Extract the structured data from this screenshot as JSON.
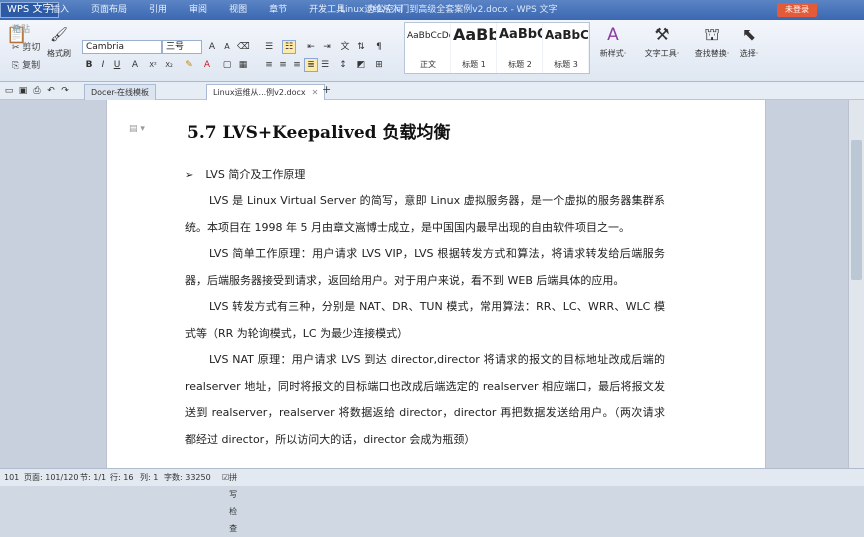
{
  "app": {
    "name": "WPS 文字",
    "doc_title": "Linux运维从入门到高级全套案例v2.docx - WPS 文字",
    "login_label": "未登录"
  },
  "menu": [
    "插入",
    "页面布局",
    "引用",
    "审阅",
    "视图",
    "章节",
    "开发工具",
    "办公空间"
  ],
  "toolbar": {
    "paste_label": "粘贴",
    "cut_label": "剪切",
    "copy_label": "复制",
    "format_painter_label": "格式刷",
    "font_name": "Cambria",
    "font_size": "三号",
    "styles": [
      {
        "preview": "AaBbCcDd",
        "name": "正文"
      },
      {
        "preview": "AaBb",
        "name": "标题 1"
      },
      {
        "preview": "AaBbC",
        "name": "标题 2"
      },
      {
        "preview": "AaBbC",
        "name": "标题 3"
      }
    ],
    "new_style_label": "新样式·",
    "text_tools_label": "文字工具·",
    "find_replace_label": "查找替换·",
    "select_label": "选择·"
  },
  "tabs": [
    {
      "label": "Docer-在线模板"
    },
    {
      "label": "Linux运维从...例v2.docx"
    }
  ],
  "document": {
    "heading": "5.7   LVS+Keepalived 负载均衡",
    "bullet": "LVS 简介及工作原理",
    "paragraphs": [
      "LVS 是 Linux Virtual Server 的简写，意即 Linux 虚拟服务器，是一个虚拟的服务器集群系统。本项目在 1998 年 5 月由章文嵩博士成立，是中国国内最早出现的自由软件项目之一。",
      "LVS 简单工作原理：用户请求 LVS VIP，LVS 根据转发方式和算法，将请求转发给后端服务器，后端服务器接受到请求，返回给用户。对于用户来说，看不到 WEB 后端具体的应用。",
      "LVS 转发方式有三种，分别是 NAT、DR、TUN 模式，常用算法：RR、LC、WRR、WLC 模式等（RR 为轮询模式，LC 为最少连接模式）",
      "LVS NAT 原理：用户请求 LVS 到达 director,director 将请求的报文的目标地址改成后端的 realserver 地址，同时将报文的目标端口也改成后端选定的 realserver 相应端口，最后将报文发送到 realserver，realserver 将数据返给 director，director 再把数据发送给用户。（两次请求都经过 director，所以访问大的话，director 会成为瓶颈）"
    ]
  },
  "status": {
    "page_num": "101",
    "pages": "页面: 101/120",
    "section": "节: 1/1",
    "row": "行: 16",
    "col": "列: 1",
    "words": "字数: 33250",
    "spell": "拼写检查"
  },
  "colors": {
    "titlebar": "#3b68b2",
    "login": "#e45b3a"
  }
}
